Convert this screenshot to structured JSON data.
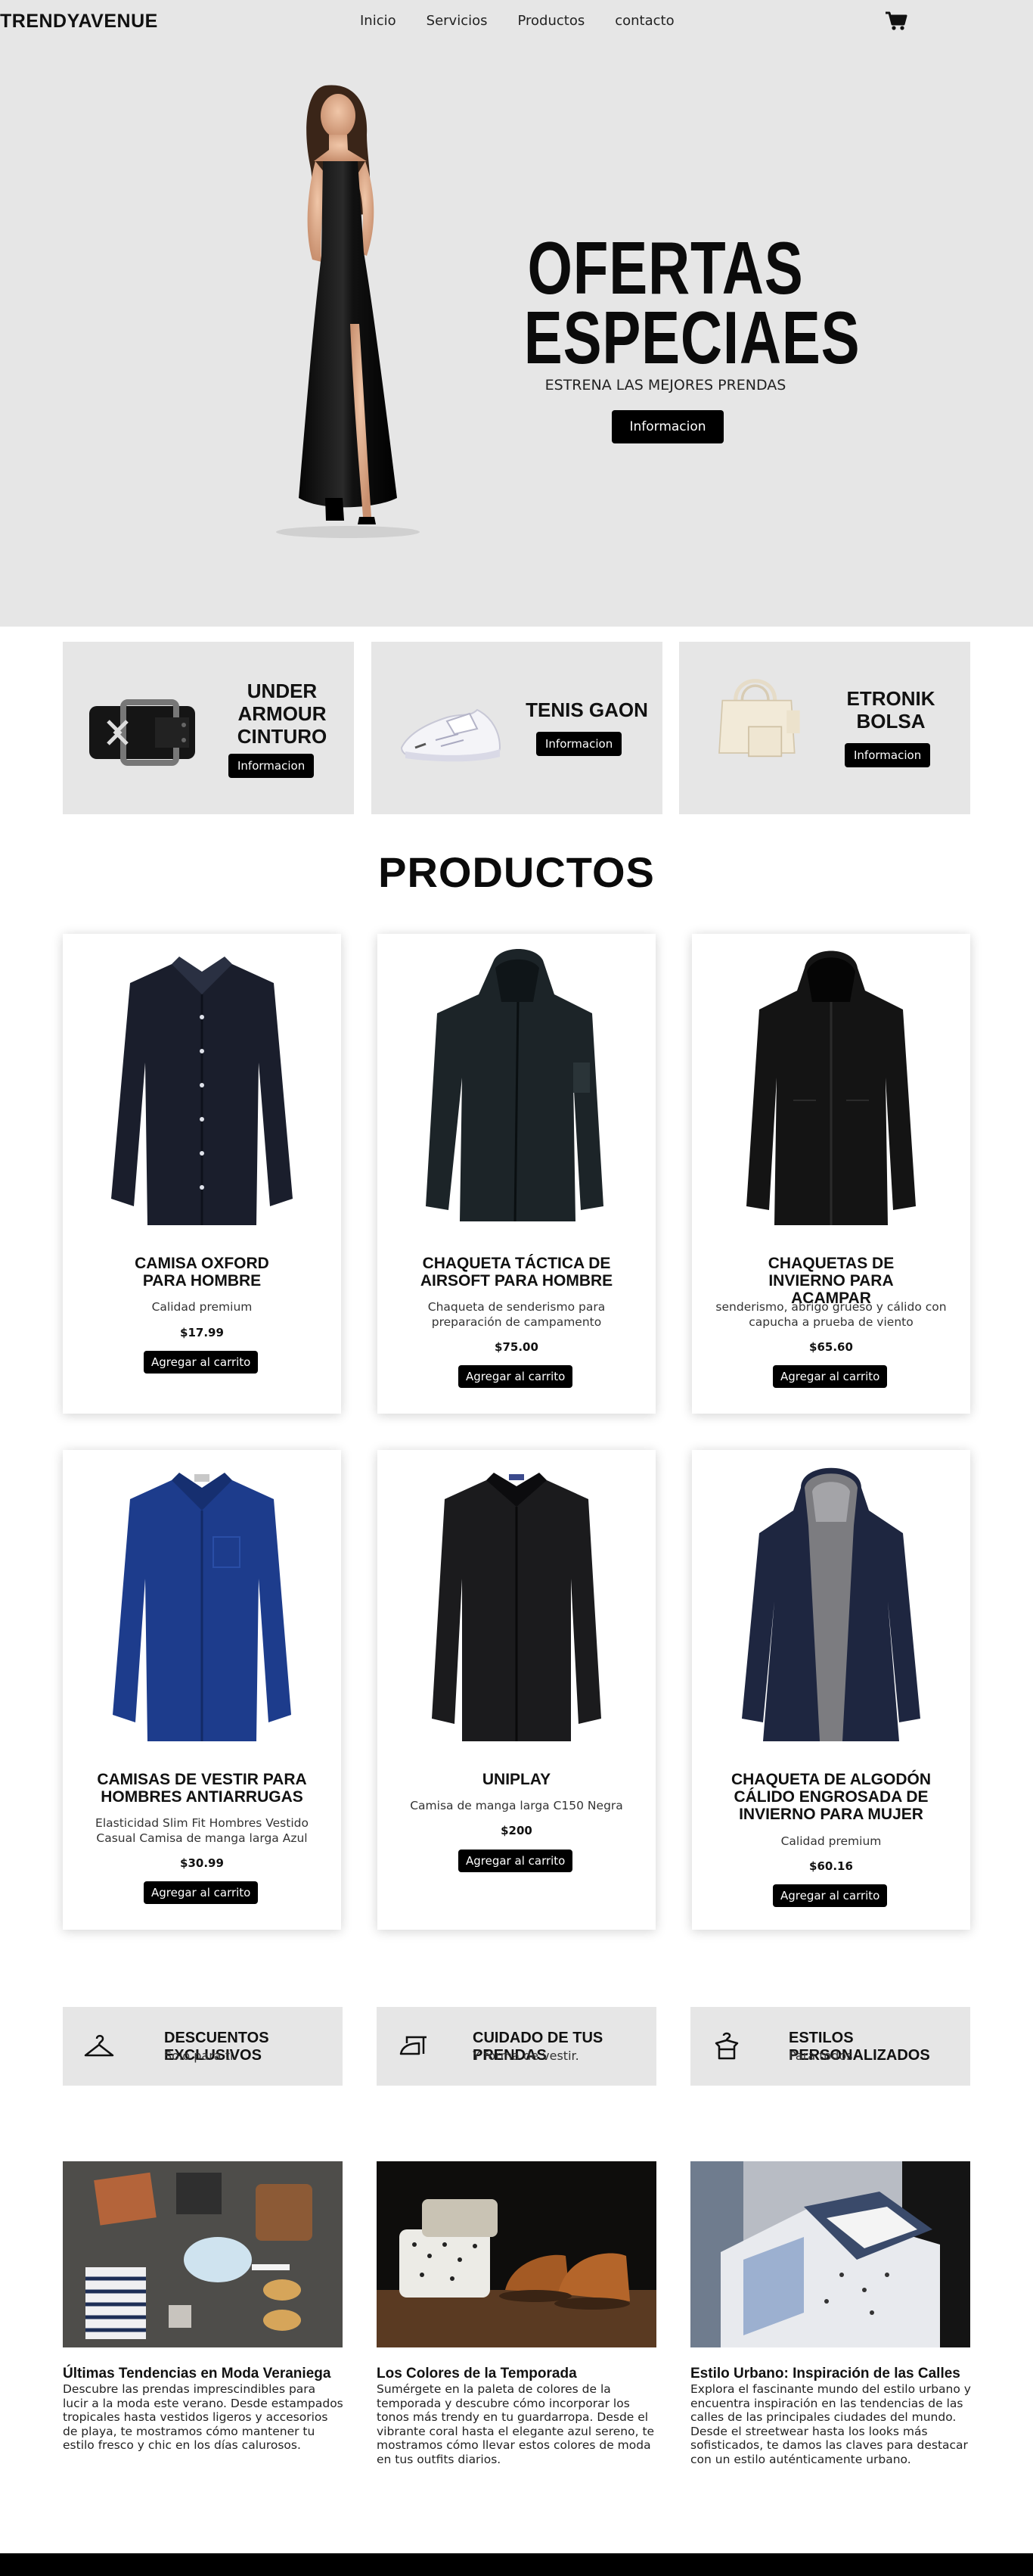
{
  "brand": "TRENDYAVENUE",
  "nav": [
    "Inicio",
    "Servicios",
    "Productos",
    "contacto"
  ],
  "hero": {
    "title_line1": "OFERTAS",
    "title_line2": "ESPECIAES",
    "subtitle": "ESTRENA LAS MEJORES PRENDAS",
    "button": "Informacion"
  },
  "featured": [
    {
      "title": "UNDER ARMOUR CINTURO",
      "button": "Informacion"
    },
    {
      "title": "TENIS GAON",
      "button": "Informacion"
    },
    {
      "title": "ETRONIK BOLSA",
      "button": "Informacion"
    }
  ],
  "products_title": "PRODUCTOS",
  "products": [
    {
      "name": "CAMISA OXFORD PARA HOMBRE",
      "desc": "Calidad premium",
      "price": "$17.99",
      "button": "Agregar al carrito"
    },
    {
      "name": "CHAQUETA TÁCTICA DE AIRSOFT PARA HOMBRE",
      "desc": "Chaqueta de senderismo para preparación de campamento",
      "price": "$75.00",
      "button": "Agregar al carrito"
    },
    {
      "name": "CHAQUETAS DE INVIERNO PARA ACAMPAR",
      "desc": "senderismo, abrigo grueso y cálido con capucha a prueba de viento",
      "price": "$65.60",
      "button": "Agregar al carrito"
    },
    {
      "name": "CAMISAS DE VESTIR PARA HOMBRES ANTIARRUGAS",
      "desc": "Elasticidad Slim Fit Hombres Vestido Casual Camisa de manga larga Azul",
      "price": "$30.99",
      "button": "Agregar al carrito"
    },
    {
      "name": "UNIPLAY",
      "desc": "Camisa de manga larga C150 Negra",
      "price": "$200",
      "button": "Agregar al carrito"
    },
    {
      "name": "CHAQUETA DE ALGODÓN CÁLIDO ENGROSADA DE INVIERNO PARA MUJER",
      "desc": "Calidad premium",
      "price": "$60.16",
      "button": "Agregar al carrito"
    }
  ],
  "services": [
    {
      "icon": "hanger-icon",
      "title": "DESCUENTOS EXCLUSIVOS",
      "subtitle": "Solo para ti."
    },
    {
      "icon": "iron-icon",
      "title": "CUIDADO DE TUS PRENDAS",
      "subtitle": "Y forma de vestir."
    },
    {
      "icon": "shirt-hanger-icon",
      "title": "ESTILOS PERSONALIZADOS",
      "subtitle": "Para todos"
    }
  ],
  "posts": [
    {
      "title": "Últimas Tendencias en Moda Veraniega",
      "body": "Descubre las prendas imprescindibles para lucir a la moda este verano. Desde estampados tropicales hasta vestidos ligeros y accesorios de playa, te mostramos cómo mantener tu estilo fresco y chic en los días calurosos."
    },
    {
      "title": "Los Colores de la Temporada",
      "body": "Sumérgete en la paleta de colores de la temporada y descubre cómo incorporar los tonos más trendy en tu guardarropa. Desde el vibrante coral hasta el elegante azul sereno, te mostramos cómo llevar estos colores de moda en tus outfits diarios."
    },
    {
      "title": "Estilo Urbano: Inspiración de las Calles",
      "body": "Explora el fascinante mundo del estilo urbano y encuentra inspiración en las tendencias de las calles de las principales ciudades del mundo. Desde el streetwear hasta los looks más sofisticados, te damos las claves para destacar con un estilo auténticamente urbano."
    }
  ]
}
